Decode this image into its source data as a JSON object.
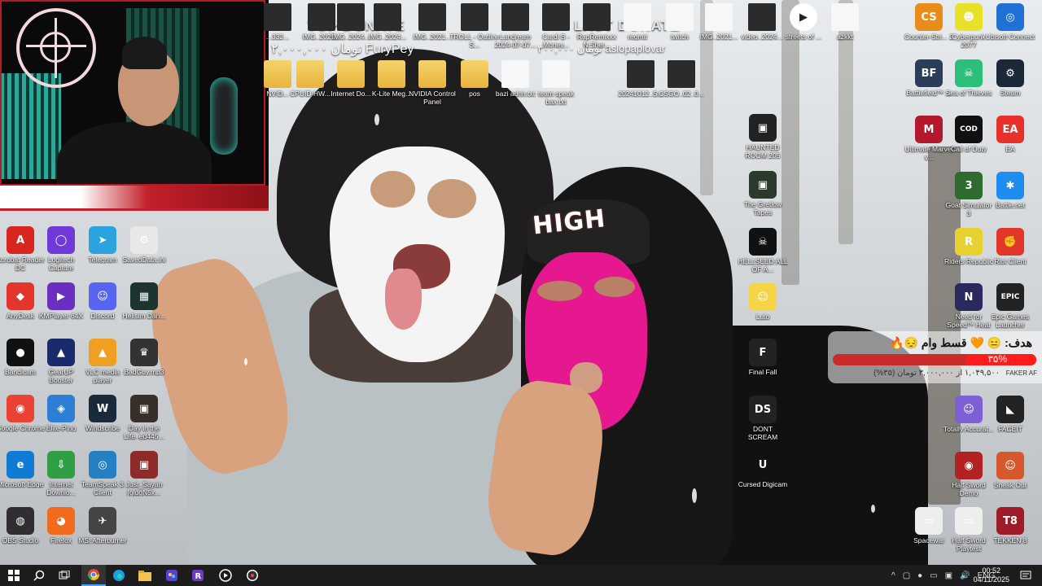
{
  "overlay": {
    "top_donate_label": "TOP DONATE",
    "top_donate_value": "۲,۰۰۰,۰۰۰ تومان FuryPey",
    "last_donate_label": "LAST DONATE",
    "last_donate_value": "۳۰۰,۰۰۰ تومان aslopaplovar"
  },
  "goal": {
    "title": "هدف: 😑 🧡 قسط وام 😔🔥",
    "percent": "۳۵%",
    "percent_value": 0.35,
    "amount": "۱,۰۴۹,۵۰۰ از ۳,۰۰۰,۰۰۰ تومان (۳۵%)",
    "channel": "FAKER AF"
  },
  "desktop_icons_top": [
    {
      "label": "...332...",
      "kind": "thumb"
    },
    {
      "label": "IMG_2025...",
      "kind": "thumb"
    },
    {
      "label": "IMG_2024...",
      "kind": "thumb"
    },
    {
      "label": "IMG_2024...",
      "kind": "thumb"
    },
    {
      "label": "IMG_2021...",
      "kind": "thumb"
    },
    {
      "label": "TROLL - Outline S...",
      "kind": "thumb"
    },
    {
      "label": "Landream 2024-07-07...",
      "kind": "thumb"
    },
    {
      "label": "Cardi B - Money...",
      "kind": "thumb"
    },
    {
      "label": "RapRemixxx N.Sher...",
      "kind": "thumb"
    },
    {
      "label": "regmit",
      "kind": "file"
    },
    {
      "label": "twitch",
      "kind": "file"
    },
    {
      "label": "IMG_2021...",
      "kind": "file"
    },
    {
      "label": "video_2024...",
      "kind": "thumb"
    },
    {
      "label": "streets of ...",
      "kind": "play"
    },
    {
      "label": "azkkt",
      "kind": "file"
    }
  ],
  "desktop_icons_row2": [
    {
      "label": "NVID...",
      "kind": "folder"
    },
    {
      "label": "CPUID HW...",
      "kind": "folder"
    },
    {
      "label": "Internet Do...",
      "kind": "folder"
    },
    {
      "label": "K-Lite Meg...",
      "kind": "folder"
    },
    {
      "label": "NVIDIA Control Panel",
      "kind": "folder"
    },
    {
      "label": "pos",
      "kind": "folder"
    },
    {
      "label": "bazi adrin.txt",
      "kind": "file"
    },
    {
      "label": "team speak bax.txt",
      "kind": "file"
    },
    {
      "label": "20241012_S...",
      "kind": "thumb"
    },
    {
      "label": "CSGO_02_0...",
      "kind": "thumb"
    }
  ],
  "desktop_icons_left": [
    {
      "label": "Acrobat Reader DC",
      "color": "#d7261f",
      "glyph": "A"
    },
    {
      "label": "Logitech Capture",
      "color": "#6f3ad8",
      "glyph": "◯"
    },
    {
      "label": "Telegram",
      "color": "#2aa3df",
      "glyph": "➤"
    },
    {
      "label": "SavedData.ini",
      "color": "#e8e8e8",
      "glyph": "⚙"
    },
    {
      "label": "AnyDesk",
      "color": "#e4352c",
      "glyph": "◆"
    },
    {
      "label": "KMPlayer 64X",
      "color": "#6a2fc0",
      "glyph": "▶"
    },
    {
      "label": "Discord",
      "color": "#5865f2",
      "glyph": "☺"
    },
    {
      "label": "Hellsim Dan...",
      "color": "#1e3430",
      "glyph": "▦"
    },
    {
      "label": "Bandicam",
      "color": "#111",
      "glyph": "●"
    },
    {
      "label": "GearUP Booster",
      "color": "#1b2a6b",
      "glyph": "▲"
    },
    {
      "label": "VLC media player",
      "color": "#f0a020",
      "glyph": "▲"
    },
    {
      "label": "BadGuy.mp3",
      "color": "#333",
      "glyph": "♛"
    },
    {
      "label": "Google Chrome",
      "color": "#ea4335",
      "glyph": "◉"
    },
    {
      "label": "Elite-Ping",
      "color": "#2d7fd6",
      "glyph": "◈"
    },
    {
      "label": "Windscribe",
      "color": "#1a2a3a",
      "glyph": "W"
    },
    {
      "label": "Day in the Life_ed445...",
      "color": "#3a2e2a",
      "glyph": "▣"
    },
    {
      "label": "Microsoft Edge",
      "color": "#0f7bd5",
      "glyph": "e"
    },
    {
      "label": "Internet Downlo...",
      "color": "#2f9e44",
      "glyph": "⇩"
    },
    {
      "label": "TeamSpeak 3 Client",
      "color": "#2580c3",
      "glyph": "◎"
    },
    {
      "label": "Just_Sayan [gldgN5x...",
      "color": "#8d2b2b",
      "glyph": "▣"
    },
    {
      "label": "OBS Studio",
      "color": "#302e31",
      "glyph": "◍"
    },
    {
      "label": "Firefox",
      "color": "#f26b1d",
      "glyph": "◕"
    },
    {
      "label": "MSI Afterburner",
      "color": "#444",
      "glyph": "✈"
    }
  ],
  "desktop_icons_mid": [
    {
      "label": "HAUNTED ROOM 205",
      "color": "#222",
      "glyph": "▣"
    },
    {
      "label": "The Gretlow Tapes",
      "color": "#2c3a2c",
      "glyph": "▣"
    },
    {
      "label": "HELLSEED ALL OF A...",
      "color": "#111",
      "glyph": "☠"
    },
    {
      "label": "Luto",
      "color": "#f4d548",
      "glyph": "☺"
    },
    {
      "label": "Final Fall",
      "color": "#222",
      "glyph": "F"
    },
    {
      "label": "DONT SCREAM",
      "color": "#222",
      "glyph": "DS"
    },
    {
      "label": "Cursed Digicam",
      "color": "#111",
      "glyph": "U"
    }
  ],
  "desktop_icons_right": [
    {
      "label": "Counter-Stri... 2",
      "color": "#e88c1a",
      "glyph": "CS"
    },
    {
      "label": "Cyberpunk 2077",
      "color": "#e8e12a",
      "glyph": "☻"
    },
    {
      "label": "Ubisoft Connect",
      "color": "#2070d6",
      "glyph": "◎"
    },
    {
      "label": "Battlefield™ ...",
      "color": "#2b3e59",
      "glyph": "BF"
    },
    {
      "label": "Sea of Thieves",
      "color": "#2cbf7b",
      "glyph": "☠"
    },
    {
      "label": "Steam",
      "color": "#1b2838",
      "glyph": "⚙"
    },
    {
      "label": "Ultimate Marvel v...",
      "color": "#b3182d",
      "glyph": "M"
    },
    {
      "label": "Call of Duty",
      "color": "#111",
      "glyph": "COD"
    },
    {
      "label": "EA",
      "color": "#e8312a",
      "glyph": "EA"
    },
    {
      "label": "Goat Simulator 3",
      "color": "#2f6b2f",
      "glyph": "3"
    },
    {
      "label": "Battle.net",
      "color": "#1f8cef",
      "glyph": "✱"
    },
    {
      "label": "Riders Republic",
      "color": "#e7d12e",
      "glyph": "R"
    },
    {
      "label": "Riot Client",
      "color": "#e2362b",
      "glyph": "✊"
    },
    {
      "label": "Need for Speed™ Heat",
      "color": "#2a2a5e",
      "glyph": "N"
    },
    {
      "label": "Epic Games Launcher",
      "color": "#222",
      "glyph": "EPIC"
    },
    {
      "label": "Totally Accurat...",
      "color": "#7d5fd6",
      "glyph": "☺"
    },
    {
      "label": "FACEIT",
      "color": "#222",
      "glyph": "◣"
    },
    {
      "label": "Half Sword Demo",
      "color": "#b22222",
      "glyph": "◉"
    },
    {
      "label": "Sneak Out",
      "color": "#d8582d",
      "glyph": "☺"
    },
    {
      "label": "Spacewar",
      "color": "#eee",
      "glyph": "▭"
    },
    {
      "label": "Half Sword Playtest",
      "color": "#eee",
      "glyph": "▭"
    },
    {
      "label": "TEKKEN 8",
      "color": "#a01b2a",
      "glyph": "T8"
    }
  ],
  "taskbar": {
    "items": [
      "windows-start",
      "search",
      "task-view",
      "chrome",
      "edge",
      "file-explorer",
      "app-store",
      "rockstar",
      "media-player",
      "obs"
    ],
    "language": "ENG",
    "time": "00:52",
    "date": "04/11/2025"
  }
}
